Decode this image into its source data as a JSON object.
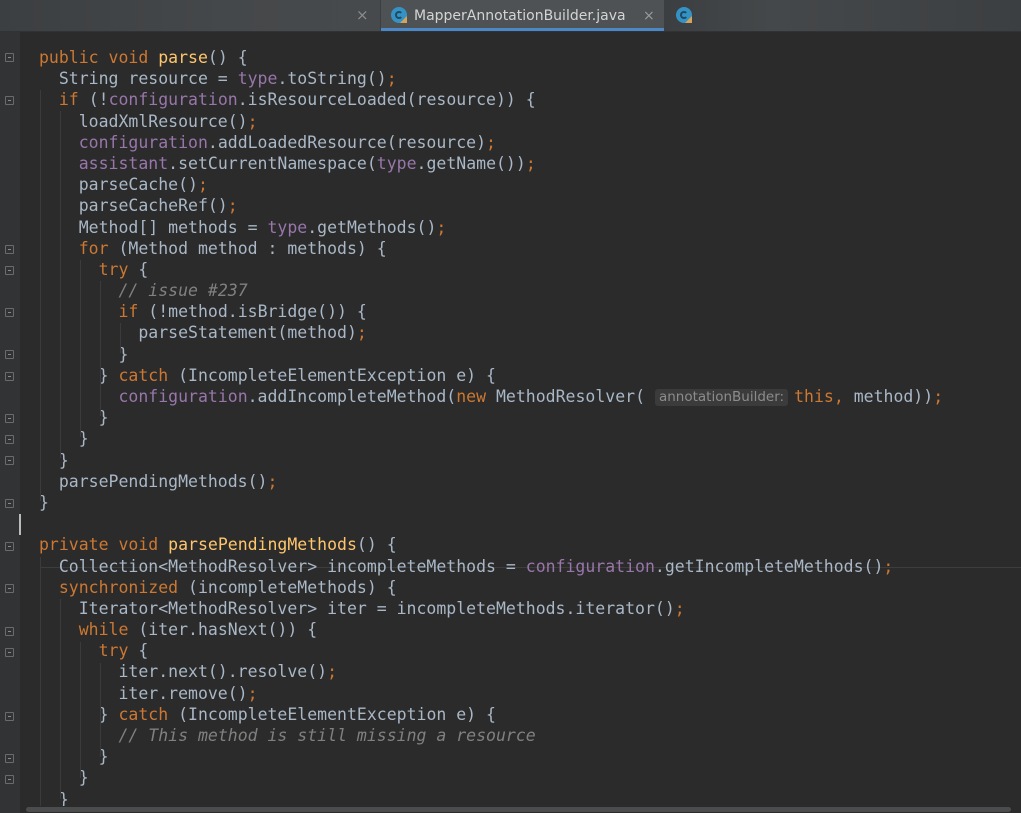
{
  "tabs": [
    {
      "label": "MapperAnnotationBuilder.java",
      "active": true,
      "close": "×"
    },
    {
      "label": "",
      "active": false
    }
  ],
  "previous_tab_close": "×",
  "code_lines": [
    [
      [
        "kw",
        "public "
      ],
      [
        "kw",
        "void "
      ],
      [
        "fn",
        "parse"
      ],
      [
        "t",
        "() {"
      ]
    ],
    [
      [
        "t",
        "  String resource = "
      ],
      [
        "fld",
        "type"
      ],
      [
        "t",
        ".toString()"
      ],
      [
        "kw",
        ";"
      ]
    ],
    [
      [
        "t",
        "  "
      ],
      [
        "kw",
        "if "
      ],
      [
        "t",
        "(!"
      ],
      [
        "fld",
        "configuration"
      ],
      [
        "t",
        ".isResourceLoaded(resource)) {"
      ]
    ],
    [
      [
        "t",
        "    loadXmlResource()"
      ],
      [
        "kw",
        ";"
      ]
    ],
    [
      [
        "t",
        "    "
      ],
      [
        "fld",
        "configuration"
      ],
      [
        "t",
        ".addLoadedResource(resource)"
      ],
      [
        "kw",
        ";"
      ]
    ],
    [
      [
        "t",
        "    "
      ],
      [
        "fld",
        "assistant"
      ],
      [
        "t",
        ".setCurrentNamespace("
      ],
      [
        "fld",
        "type"
      ],
      [
        "t",
        ".getName())"
      ],
      [
        "kw",
        ";"
      ]
    ],
    [
      [
        "t",
        "    parseCache()"
      ],
      [
        "kw",
        ";"
      ]
    ],
    [
      [
        "t",
        "    parseCacheRef()"
      ],
      [
        "kw",
        ";"
      ]
    ],
    [
      [
        "t",
        "    Method[] methods = "
      ],
      [
        "fld",
        "type"
      ],
      [
        "t",
        ".getMethods()"
      ],
      [
        "kw",
        ";"
      ]
    ],
    [
      [
        "t",
        "    "
      ],
      [
        "kw",
        "for "
      ],
      [
        "t",
        "(Method method : methods) {"
      ]
    ],
    [
      [
        "t",
        "      "
      ],
      [
        "kw",
        "try "
      ],
      [
        "t",
        "{"
      ]
    ],
    [
      [
        "t",
        "        "
      ],
      [
        "cmt",
        "// issue #237"
      ]
    ],
    [
      [
        "t",
        "        "
      ],
      [
        "kw",
        "if "
      ],
      [
        "t",
        "(!method.isBridge()) {"
      ]
    ],
    [
      [
        "t",
        "          parseStatement(method)"
      ],
      [
        "kw",
        ";"
      ]
    ],
    [
      [
        "t",
        "        }"
      ]
    ],
    [
      [
        "t",
        "      } "
      ],
      [
        "kw",
        "catch "
      ],
      [
        "t",
        "(IncompleteElementException e) {"
      ]
    ],
    [
      [
        "t",
        "        "
      ],
      [
        "fld",
        "configuration"
      ],
      [
        "t",
        ".addIncompleteMethod("
      ],
      [
        "kw",
        "new "
      ],
      [
        "t",
        "MethodResolver( "
      ],
      [
        "hint",
        "annotationBuilder:"
      ],
      [
        "kw",
        "this, "
      ],
      [
        "t",
        "method))"
      ],
      [
        "kw",
        ";"
      ]
    ],
    [
      [
        "t",
        "      }"
      ]
    ],
    [
      [
        "t",
        "    }"
      ]
    ],
    [
      [
        "t",
        "  }"
      ]
    ],
    [
      [
        "t",
        "  parsePendingMethods()"
      ],
      [
        "kw",
        ";"
      ]
    ],
    [
      [
        "t",
        "}"
      ]
    ],
    [
      [
        "t",
        ""
      ]
    ],
    [
      [
        "kw",
        "private "
      ],
      [
        "kw",
        "void "
      ],
      [
        "fn",
        "parsePendingMethods"
      ],
      [
        "t",
        "() {"
      ]
    ],
    [
      [
        "t",
        "  Collection<MethodResolver> incompleteMethods = "
      ],
      [
        "fld",
        "configuration"
      ],
      [
        "t",
        ".getIncompleteMethods()"
      ],
      [
        "kw",
        ";"
      ]
    ],
    [
      [
        "t",
        "  "
      ],
      [
        "kw",
        "synchronized "
      ],
      [
        "t",
        "(incompleteMethods) {"
      ]
    ],
    [
      [
        "t",
        "    Iterator<MethodResolver> iter = incompleteMethods.iterator()"
      ],
      [
        "kw",
        ";"
      ]
    ],
    [
      [
        "t",
        "    "
      ],
      [
        "kw",
        "while "
      ],
      [
        "t",
        "(iter.hasNext()) {"
      ]
    ],
    [
      [
        "t",
        "      "
      ],
      [
        "kw",
        "try "
      ],
      [
        "t",
        "{"
      ]
    ],
    [
      [
        "t",
        "        iter.next().resolve()"
      ],
      [
        "kw",
        ";"
      ]
    ],
    [
      [
        "t",
        "        iter.remove()"
      ],
      [
        "kw",
        ";"
      ]
    ],
    [
      [
        "t",
        "      } "
      ],
      [
        "kw",
        "catch "
      ],
      [
        "t",
        "(IncompleteElementException e) {"
      ]
    ],
    [
      [
        "t",
        "        "
      ],
      [
        "cmt",
        "// This method is still missing a resource"
      ]
    ],
    [
      [
        "t",
        "      }"
      ]
    ],
    [
      [
        "t",
        "    }"
      ]
    ],
    [
      [
        "t",
        "  }"
      ]
    ]
  ],
  "caret_line": 22,
  "colors": {
    "background": "#2b2b2b",
    "gutter": "#313335",
    "keyword": "#cc7832",
    "field": "#9876aa",
    "method_declaration": "#ffc66d",
    "comment": "#808080",
    "default_text": "#a9b7c6",
    "tab_accent": "#4a88c7"
  },
  "icons": [
    "class-icon",
    "fold-marker-icon",
    "close-icon"
  ]
}
